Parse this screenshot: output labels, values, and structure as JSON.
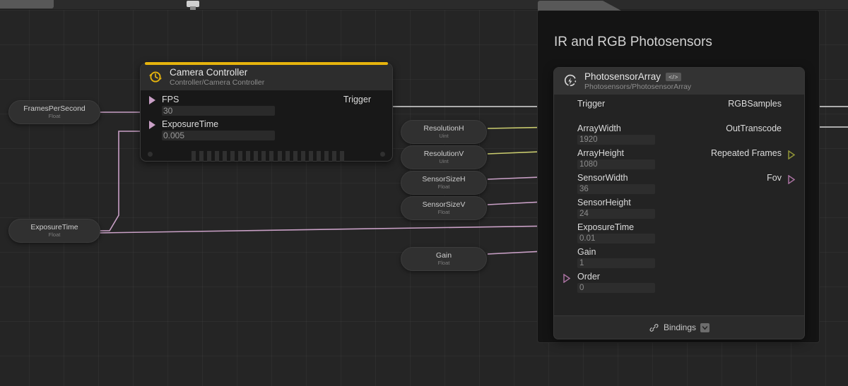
{
  "app": {
    "canvas_background": "#252525",
    "grid_color": "#333333"
  },
  "topbar": {
    "tab_label": "",
    "chip_label": ""
  },
  "group": {
    "title": "IR and RGB Photosensors",
    "tab_label": ""
  },
  "camera_node": {
    "title": "Camera Controller",
    "subtitle": "Controller/Camera Controller",
    "accent_color": "#e6b40d",
    "icon": "clock-refresh-icon",
    "inputs": [
      {
        "label": "FPS",
        "value": "30",
        "port_color": "#c9a0c6",
        "port_style": "filled"
      },
      {
        "label": "ExposureTime",
        "value": "0.005",
        "port_color": "#c9a0c6",
        "port_style": "filled"
      }
    ],
    "outputs": [
      {
        "label": "Trigger",
        "port_color": "#e8e8e8",
        "port_style": "filled"
      }
    ]
  },
  "photosensor_node": {
    "title": "PhotosensorArray",
    "subtitle": "Photosensors/PhotosensorArray",
    "badge": "</>",
    "icon": "bolt-circle-icon",
    "inputs": [
      {
        "label": "Trigger",
        "value": "",
        "port_color": "#e8e8e8",
        "port_style": "filled"
      },
      {
        "label": "ArrayWidth",
        "value": "1920",
        "port_color": "#c9cb6e",
        "port_style": "filled"
      },
      {
        "label": "ArrayHeight",
        "value": "1080",
        "port_color": "#c9cb6e",
        "port_style": "filled"
      },
      {
        "label": "SensorWidth",
        "value": "36",
        "port_color": "#c9a0c6",
        "port_style": "filled"
      },
      {
        "label": "SensorHeight",
        "value": "24",
        "port_color": "#c9a0c6",
        "port_style": "filled"
      },
      {
        "label": "ExposureTime",
        "value": "0.01",
        "port_color": "#c9a0c6",
        "port_style": "filled"
      },
      {
        "label": "Gain",
        "value": "1",
        "port_color": "#c9a0c6",
        "port_style": "filled"
      },
      {
        "label": "Order",
        "value": "0",
        "port_color": "#a8719f",
        "port_style": "hollow"
      }
    ],
    "outputs": [
      {
        "label": "RGBSamples",
        "port_color": "#e8e8e8",
        "port_style": "filled"
      },
      {
        "label": "OutTranscode",
        "port_color": "#e8e8e8",
        "port_style": "filled"
      },
      {
        "label": "Repeated Frames",
        "port_color": "#909337",
        "port_style": "hollow"
      },
      {
        "label": "Fov",
        "port_color": "#a8719f",
        "port_style": "hollow"
      }
    ],
    "bindings_label": "Bindings",
    "bindings_icon": "link-icon",
    "bindings_checked": true
  },
  "variable_nodes": [
    {
      "name": "FramesPerSecond",
      "type": "Float",
      "port_color": "#c9a0c6"
    },
    {
      "name": "ExposureTime",
      "type": "Float",
      "port_color": "#c9a0c6"
    },
    {
      "name": "ResolutionH",
      "type": "Uint",
      "port_color": "#c9cb6e"
    },
    {
      "name": "ResolutionV",
      "type": "Uint",
      "port_color": "#c9cb6e"
    },
    {
      "name": "SensorSizeH",
      "type": "Float",
      "port_color": "#c9a0c6"
    },
    {
      "name": "SensorSizeV",
      "type": "Float",
      "port_color": "#c9a0c6"
    },
    {
      "name": "Gain",
      "type": "Float",
      "port_color": "#c9a0c6"
    }
  ],
  "wires": {
    "data_color": "#c9a0c6",
    "exec_color": "#d9d9d9"
  }
}
